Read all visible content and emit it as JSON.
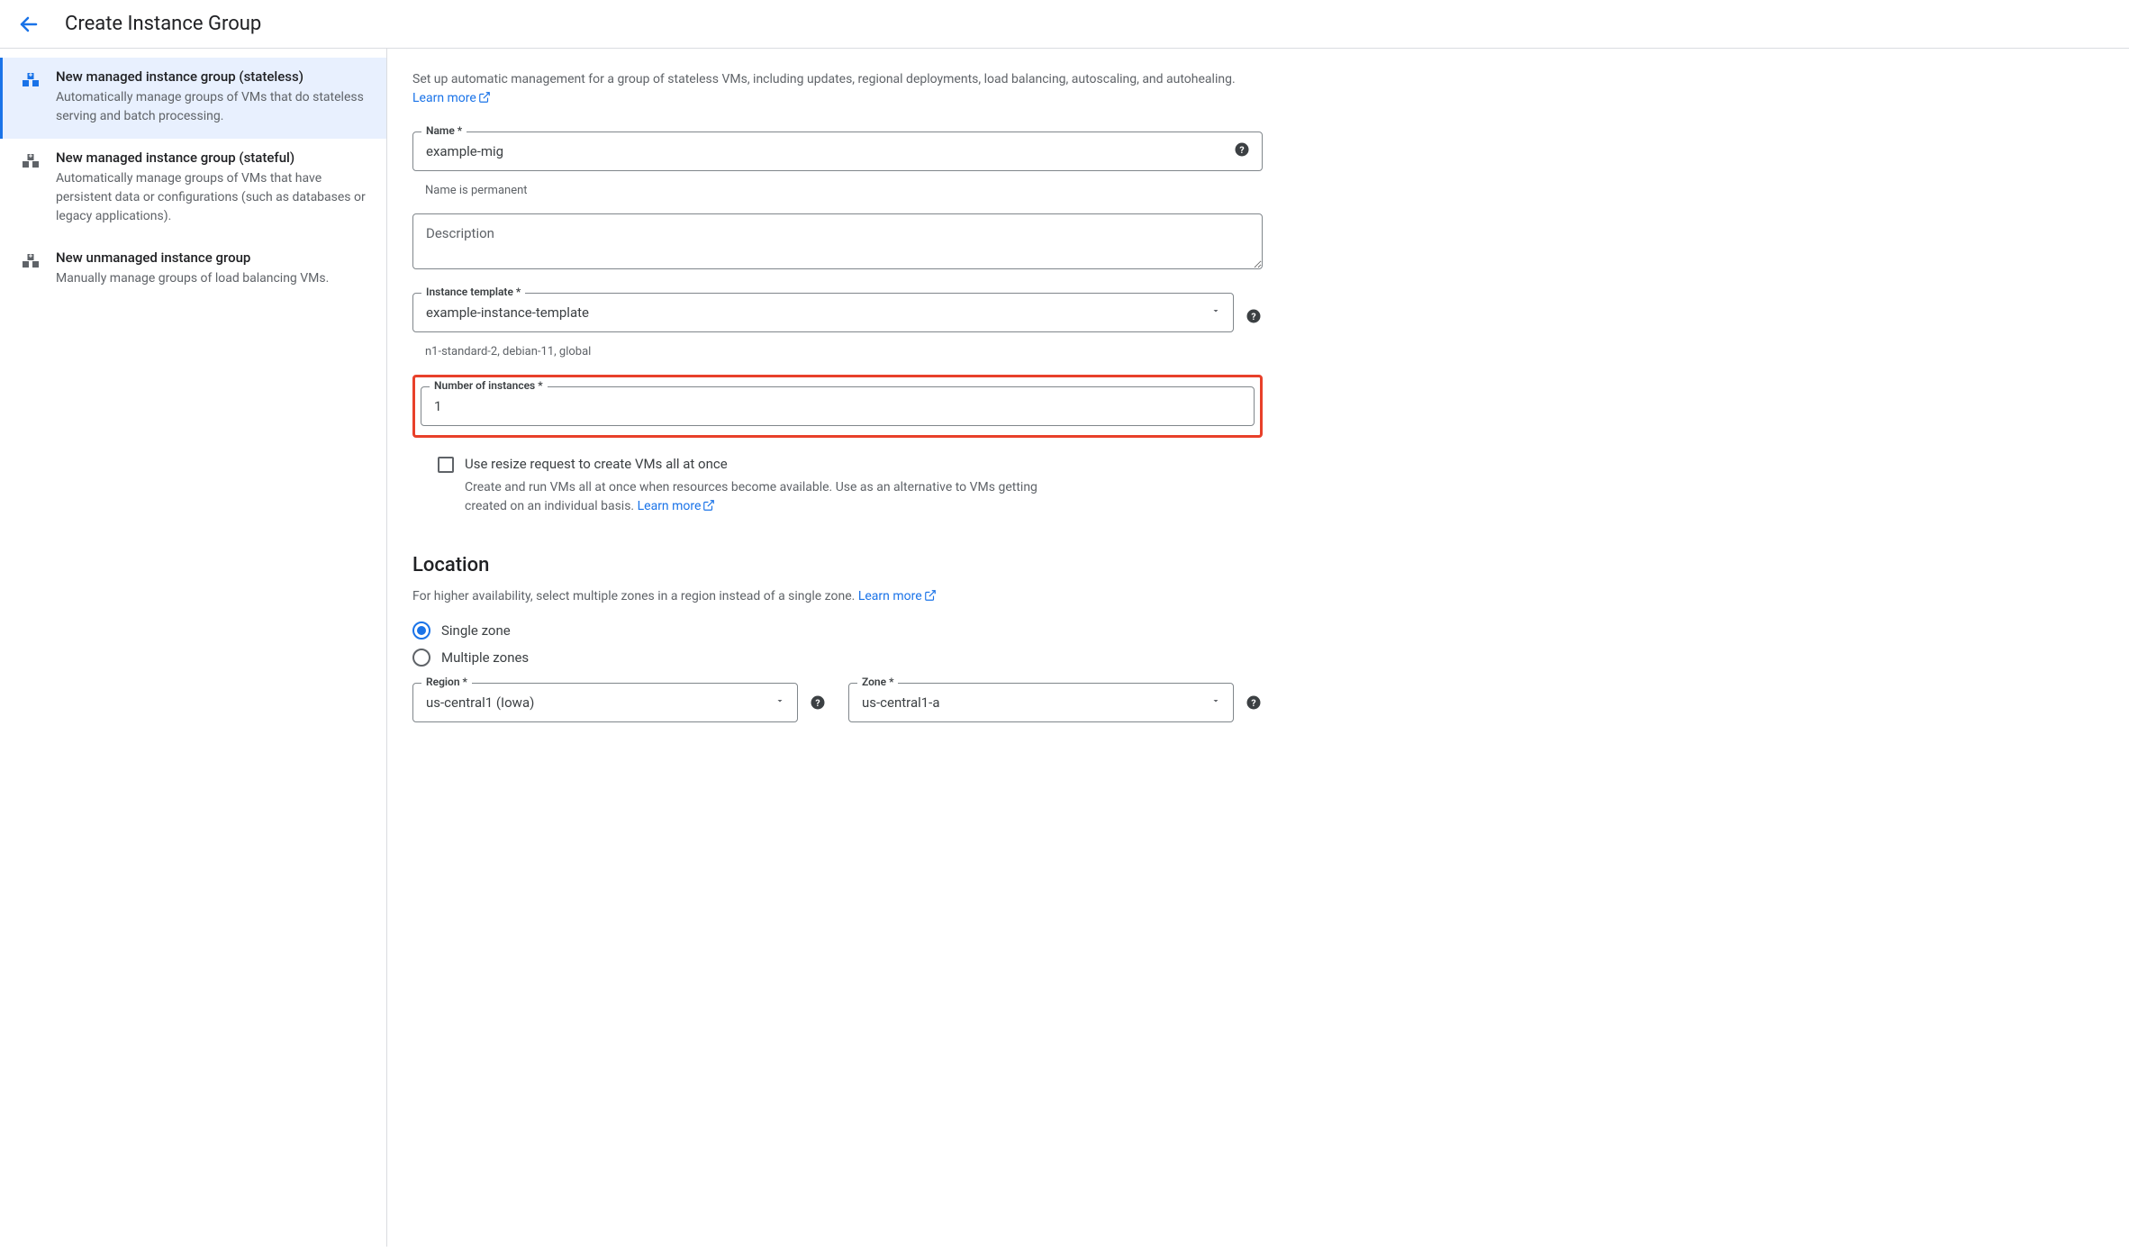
{
  "header": {
    "title": "Create Instance Group"
  },
  "sidebar": {
    "items": [
      {
        "title": "New managed instance group (stateless)",
        "desc": "Automatically manage groups of VMs that do stateless serving and batch processing."
      },
      {
        "title": "New managed instance group (stateful)",
        "desc": "Automatically manage groups of VMs that have persistent data or configurations (such as databases or legacy applications)."
      },
      {
        "title": "New unmanaged instance group",
        "desc": "Manually manage groups of load balancing VMs."
      }
    ]
  },
  "main": {
    "intro": "Set up automatic management for a group of stateless VMs, including updates, regional deployments, load balancing, autoscaling, and autohealing.",
    "learn_more": "Learn more",
    "fields": {
      "name_label": "Name *",
      "name_value": "example-mig",
      "name_helper": "Name is permanent",
      "description_placeholder": "Description",
      "template_label": "Instance template *",
      "template_value": "example-instance-template",
      "template_helper": "n1-standard-2, debian-11, global",
      "num_label": "Number of instances *",
      "num_value": "1",
      "resize_label": "Use resize request to create VMs all at once",
      "resize_desc": "Create and run VMs all at once when resources become available. Use as an alternative to VMs getting created on an individual basis."
    },
    "location": {
      "title": "Location",
      "desc": "For higher availability, select multiple zones in a region instead of a single zone.",
      "single": "Single zone",
      "multiple": "Multiple zones",
      "region_label": "Region *",
      "region_value": "us-central1 (Iowa)",
      "zone_label": "Zone *",
      "zone_value": "us-central1-a"
    }
  }
}
